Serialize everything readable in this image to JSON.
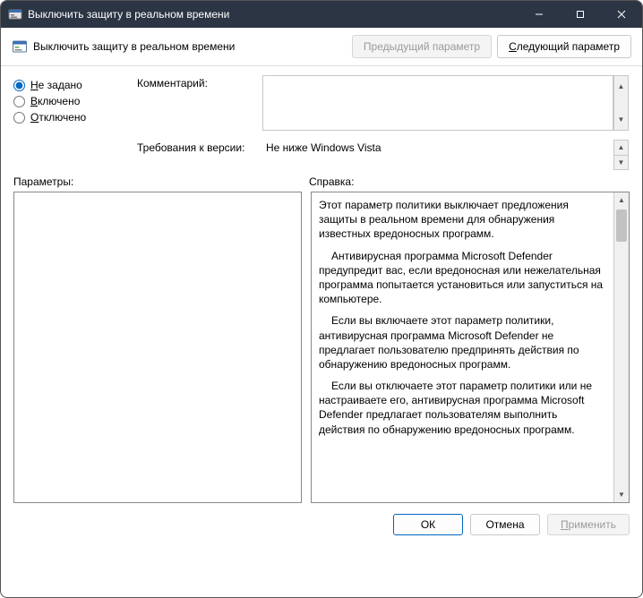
{
  "title": "Выключить защиту в реальном времени",
  "toolbar": {
    "title": "Выключить защиту в реальном времени",
    "prev": "Предыдущий параметр",
    "next_prefix": "С",
    "next_rest": "ледующий параметр"
  },
  "options": {
    "not_configured_prefix": "Н",
    "not_configured_rest": "е задано",
    "enabled_prefix": "В",
    "enabled_rest": "ключено",
    "disabled_prefix": "О",
    "disabled_rest": "тключено",
    "selected": "not_configured"
  },
  "fields": {
    "comment_label": "Комментарий:",
    "comment_value": "",
    "requirements_label": "Требования к версии:",
    "requirements_value": "Не ниже Windows Vista"
  },
  "sections": {
    "params": "Параметры:",
    "help": "Справка:"
  },
  "help_paragraphs": [
    "Этот параметр политики выключает предложения защиты в реальном времени для обнаружения известных вредоносных программ.",
    "Антивирусная программа Microsoft Defender предупредит вас, если вредоносная или нежелательная программа попытается установиться или запуститься на компьютере.",
    "Если вы включаете этот параметр политики, антивирусная программа Microsoft Defender не предлагает пользователю предпринять действия по обнаружению вредоносных программ.",
    "Если вы отключаете этот параметр политики или не настраиваете его, антивирусная программа Microsoft Defender предлагает пользователям выполнить действия по обнаружению вредоносных программ."
  ],
  "footer": {
    "ok": "ОК",
    "cancel": "Отмена",
    "apply_prefix": "П",
    "apply_rest": "рименить"
  }
}
